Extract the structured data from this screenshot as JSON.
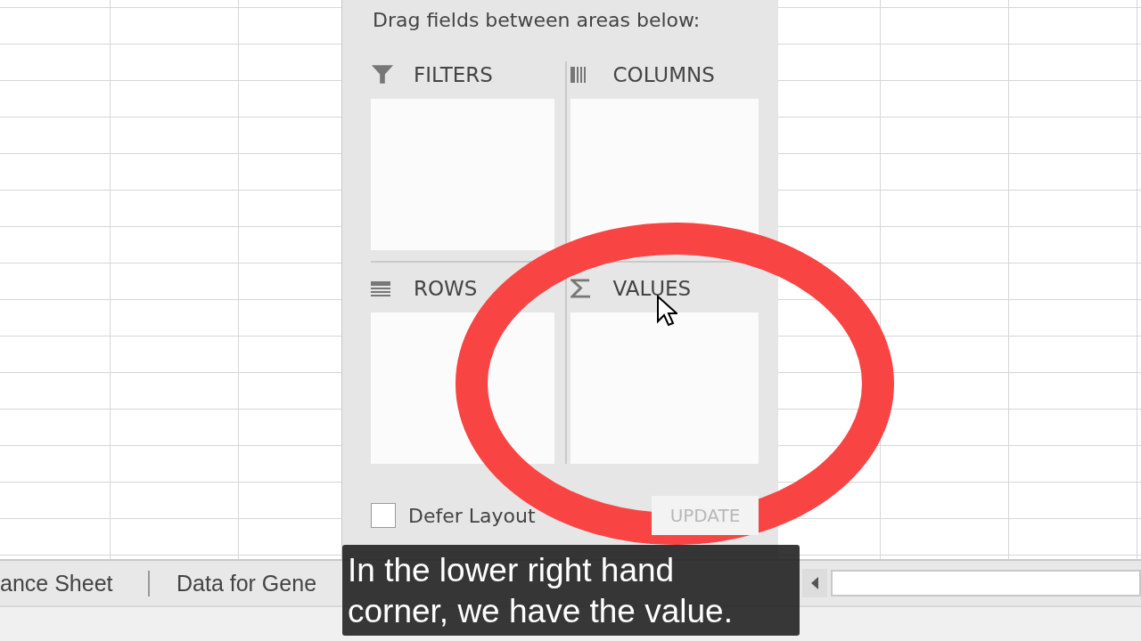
{
  "panel": {
    "instruction": "Drag fields between areas below:",
    "areas": [
      {
        "kind": "filters",
        "label": "FILTERS"
      },
      {
        "kind": "columns",
        "label": "COLUMNS"
      },
      {
        "kind": "rows",
        "label": "ROWS"
      },
      {
        "kind": "values",
        "label": "VALUES"
      }
    ],
    "defer_layout": {
      "label": "Defer Layout",
      "checked": false
    },
    "update_button": {
      "label": "UPDATE",
      "disabled": true
    }
  },
  "sheet_tabs": [
    {
      "label": "ance Sheet"
    },
    {
      "label": "Data for Gene"
    }
  ],
  "caption": [
    "In the lower right hand",
    "corner, we have the value."
  ]
}
